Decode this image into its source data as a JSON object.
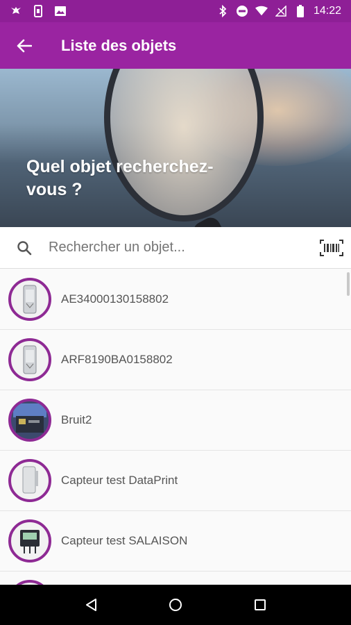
{
  "status": {
    "time": "14:22",
    "left_icons": [
      "notification-icon",
      "phone-icon",
      "image-icon"
    ],
    "right_icons": [
      "bluetooth-icon",
      "do-not-disturb-icon",
      "wifi-icon",
      "no-signal-icon",
      "battery-icon"
    ]
  },
  "app_bar": {
    "title": "Liste des objets",
    "background": "#9a24a1"
  },
  "hero": {
    "text": "Quel objet recherchez-vous ?"
  },
  "search": {
    "placeholder": "Rechercher un objet..."
  },
  "list": {
    "items": [
      {
        "label": "AE34000130158802",
        "icon": "sensor-icon"
      },
      {
        "label": "ARF8190BA0158802",
        "icon": "sensor-icon"
      },
      {
        "label": "Bruit2",
        "icon": "device-board-icon"
      },
      {
        "label": "Capteur test DataPrint",
        "icon": "sensor-icon"
      },
      {
        "label": "Capteur test SALAISON",
        "icon": "data-logger-icon"
      }
    ]
  },
  "colors": {
    "accent": "#9a24a1",
    "status_bar": "#8e1f96",
    "avatar_border": "#8e2a94"
  }
}
